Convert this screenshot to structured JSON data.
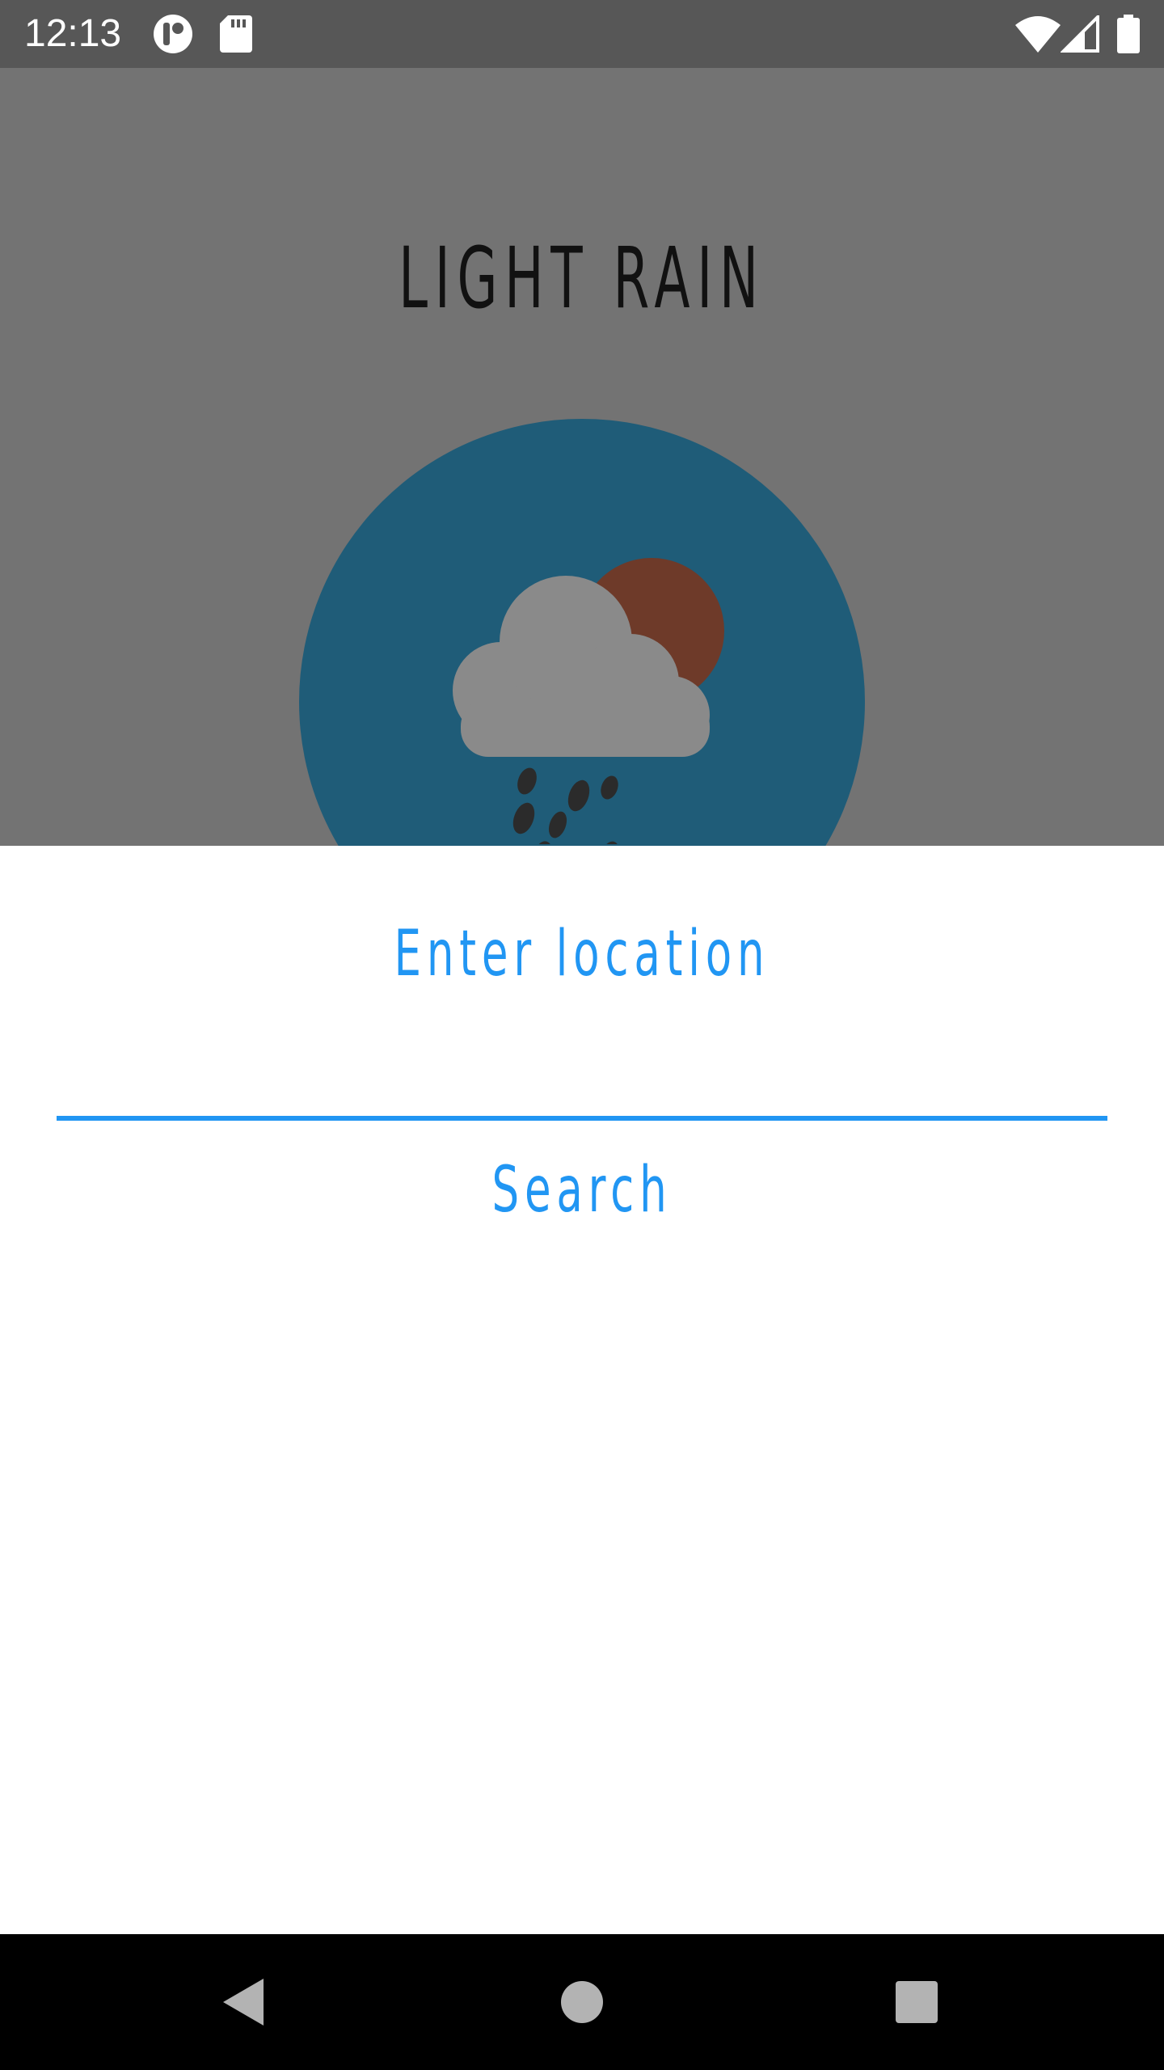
{
  "status_bar": {
    "time": "12:13",
    "icons": [
      "notification-app-icon",
      "sd-card-icon",
      "wifi-icon",
      "cell-signal-icon",
      "battery-icon"
    ]
  },
  "background_app": {
    "condition": "LIGHT RAIN",
    "circle_color": "#1f5c78",
    "weather_icon": "cloud-sun-rain-icon"
  },
  "bottom_sheet": {
    "title": "Enter location",
    "input_value": "",
    "search_label": "Search",
    "accent_color": "#2196f3"
  },
  "nav_bar": {
    "buttons": [
      "back-icon",
      "home-icon",
      "recents-icon"
    ]
  }
}
